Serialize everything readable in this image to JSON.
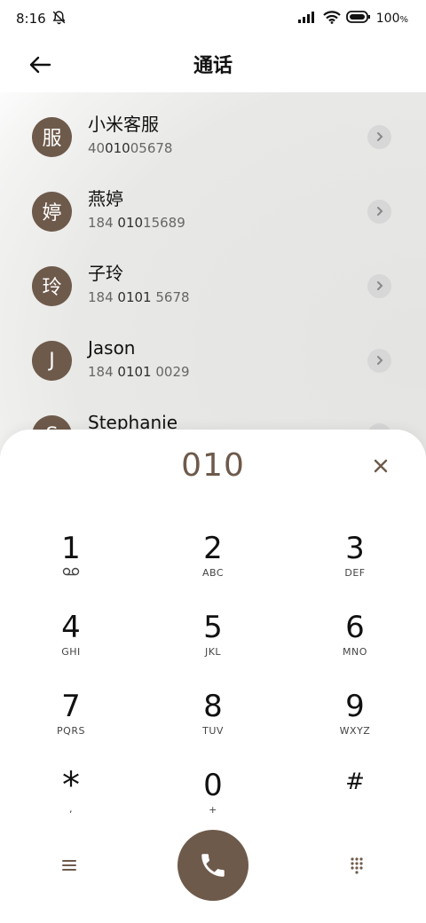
{
  "status": {
    "time": "8:16",
    "battery": "100"
  },
  "header": {
    "title": "通话"
  },
  "contacts": [
    {
      "initial": "服",
      "name": "小米客服",
      "num_pre": "40",
      "num_match": "010",
      "num_post": "05678"
    },
    {
      "initial": "婷",
      "name": "燕婷",
      "num_pre": "184 ",
      "num_match": "010",
      "num_post": "15689"
    },
    {
      "initial": "玲",
      "name": "子玲",
      "num_pre": "184 ",
      "num_match": "0101",
      "num_post": " 5678"
    },
    {
      "initial": "J",
      "name": "Jason",
      "num_pre": "184 ",
      "num_match": "0101",
      "num_post": " 0029"
    },
    {
      "initial": "S",
      "name": "Stephanie",
      "num_pre": "",
      "num_match": "",
      "num_post": ""
    }
  ],
  "dialer": {
    "input": "010",
    "keys": [
      {
        "digit": "1",
        "sub": "voicemail-icon"
      },
      {
        "digit": "2",
        "sub": "ABC"
      },
      {
        "digit": "3",
        "sub": "DEF"
      },
      {
        "digit": "4",
        "sub": "GHI"
      },
      {
        "digit": "5",
        "sub": "JKL"
      },
      {
        "digit": "6",
        "sub": "MNO"
      },
      {
        "digit": "7",
        "sub": "PQRS"
      },
      {
        "digit": "8",
        "sub": "TUV"
      },
      {
        "digit": "9",
        "sub": "WXYZ"
      },
      {
        "digit": "*",
        "sub": ","
      },
      {
        "digit": "0",
        "sub": "+"
      },
      {
        "digit": "#",
        "sub": ""
      }
    ]
  },
  "colors": {
    "accent": "#6e5a4b",
    "avatar_bg": "#6e5a4b"
  }
}
